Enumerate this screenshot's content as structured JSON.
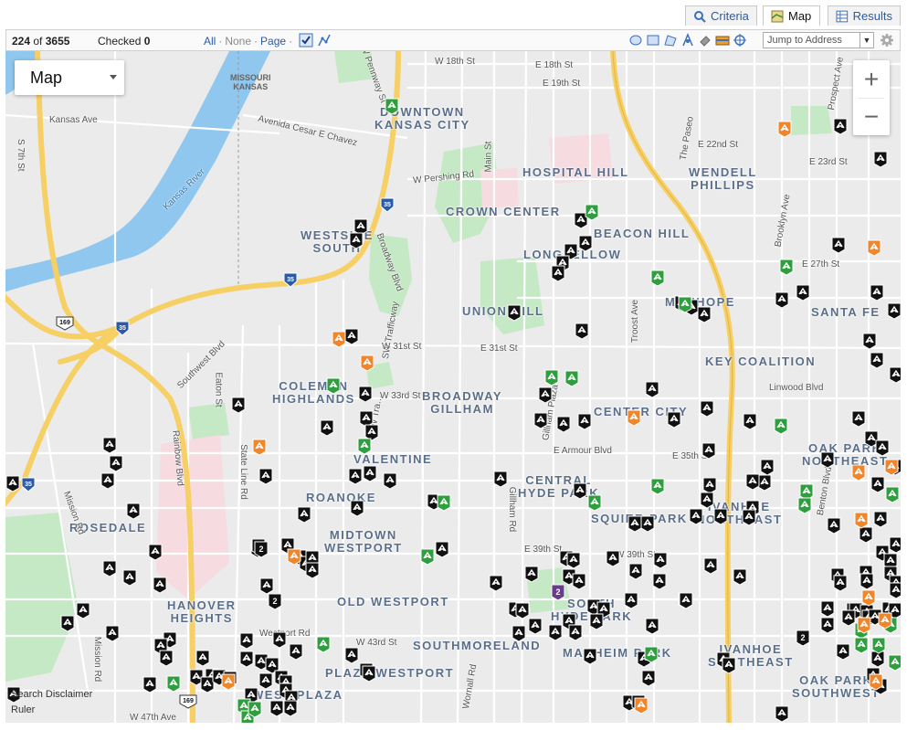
{
  "tabs": [
    {
      "label": "Criteria",
      "icon": "magnifier-icon",
      "active": false
    },
    {
      "label": "Map",
      "icon": "map-icon",
      "active": true
    },
    {
      "label": "Results",
      "icon": "grid-icon",
      "active": false
    }
  ],
  "toolbar": {
    "shown": "224",
    "of_word": "of",
    "total": "3655",
    "checked_label": "Checked",
    "checked_value": "0",
    "link_all": "All",
    "link_none": "None",
    "link_page": "Page",
    "jump_placeholder": "Jump to Address"
  },
  "map": {
    "type_label": "Map",
    "zoom_in": "+",
    "zoom_out": "−",
    "credits": [
      "Search Disclaimer",
      "Ruler"
    ],
    "neighborhoods": [
      {
        "text": "DOWNTOWN\nKANSAS CITY"
      },
      {
        "text": "HOSPITAL HILL"
      },
      {
        "text": "WENDELL\nPHILLIPS"
      },
      {
        "text": "CROWN CENTER"
      },
      {
        "text": "BEACON HILL"
      },
      {
        "text": "WESTSIDE\nSOUTH"
      },
      {
        "text": "LONGFELLOW"
      },
      {
        "text": "UNION HILL"
      },
      {
        "text": "MANHOPE"
      },
      {
        "text": "SANTA FE"
      },
      {
        "text": "KEY COALITION"
      },
      {
        "text": "COLEMAN\nHIGHLANDS"
      },
      {
        "text": "BROADWAY\nGILLHAM"
      },
      {
        "text": "CENTER CITY"
      },
      {
        "text": "VALENTINE"
      },
      {
        "text": "OAK PARK\nNORTHEAST"
      },
      {
        "text": "CENTRAL\nHYDE PARK"
      },
      {
        "text": "ROANOKE"
      },
      {
        "text": "IVANHOE\nNORTHEAST"
      },
      {
        "text": "SQUIER PARK"
      },
      {
        "text": "ROSEDALE"
      },
      {
        "text": "MIDTOWN\nWESTPORT"
      },
      {
        "text": "OLD WESTPORT"
      },
      {
        "text": "SOUTH\nHYDE PARK"
      },
      {
        "text": "HANOVER\nHEIGHTS"
      },
      {
        "text": "SOUTHMORELAND"
      },
      {
        "text": "MANHEIM PARK"
      },
      {
        "text": "IVANHOE\nSOUTHEAST"
      },
      {
        "text": "PLAZA WESTPORT"
      },
      {
        "text": "OAK PARK\nSOUTHWEST"
      },
      {
        "text": "WEST PLAZA"
      },
      {
        "text": "MISSOURI\nKANSAS"
      }
    ],
    "streets": [
      "W 18th St",
      "E 18th St",
      "E 19th St",
      "Kansas Ave",
      "S 7th St",
      "Avenida Cesar E Chavez",
      "Kansas River",
      "W Pershing Rd",
      "E 22nd St",
      "E 23rd St",
      "Broadway Blvd",
      "SW Trafficway",
      "W 31st St",
      "E 31st St",
      "Southwest Blvd",
      "Rainbow Blvd",
      "State Line Rd",
      "Eaton St",
      "SW Tra…",
      "W 33rd St",
      "Linwood Blvd",
      "E Armour Blvd",
      "E 35th St",
      "Mission Rd",
      "E 39th St",
      "W 39th St",
      "Gillham Rd",
      "Westport Rd",
      "W 43rd St",
      "W 47th Ave",
      "The Paseo",
      "Troost Ave",
      "Main St",
      "Prospect Ave",
      "Brooklyn Ave",
      "E 27th St",
      "W Pennway St",
      "Gillham Plaza",
      "Mission Rd",
      "Wornall Rd",
      "Benton Blvd"
    ],
    "highway_shields": [
      "35",
      "169",
      "35",
      "35",
      "35",
      "169"
    ],
    "markers": {
      "black_count_note": "",
      "cluster_labels": [
        "2",
        "2",
        "2",
        "2"
      ]
    }
  },
  "colors": {
    "accent": "#2a5aa8",
    "marker_black": "#111111",
    "marker_green": "#2e9e3e",
    "marker_orange": "#f0852a",
    "cluster_purple": "#6a3d8c",
    "highway": "#f6cf65",
    "river": "#8fc7ee",
    "park": "#c5e8c5",
    "hospital": "#f6dbe0"
  }
}
